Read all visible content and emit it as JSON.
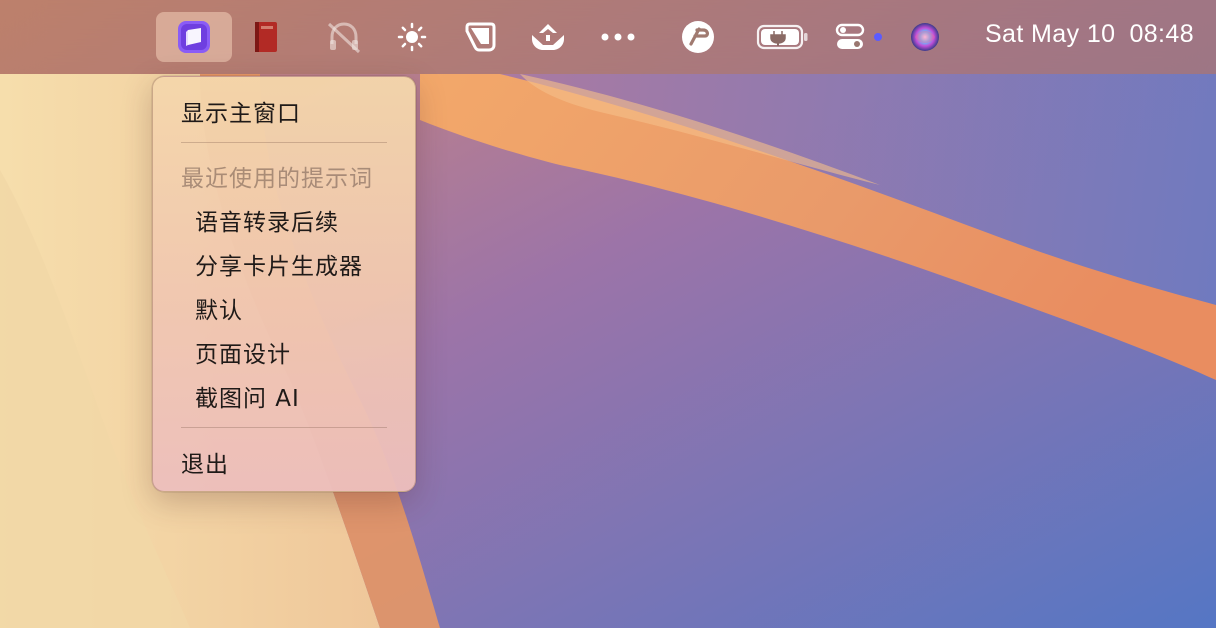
{
  "menubar": {
    "icons": [
      {
        "name": "prompt-app-icon",
        "color": "#7c4dff"
      },
      {
        "name": "book-icon",
        "color": "#c0392b"
      },
      {
        "name": "headphones-off-icon"
      },
      {
        "name": "brightness-icon"
      },
      {
        "name": "screenshot-icon"
      },
      {
        "name": "inbox-tray-icon"
      },
      {
        "name": "more-icon"
      },
      {
        "name": "remote-desktop-icon"
      },
      {
        "name": "battery-charging-icon"
      },
      {
        "name": "control-center-icon"
      },
      {
        "name": "siri-icon"
      }
    ],
    "date": "Sat May 10",
    "time": "08:48",
    "indicator_dot_color": "#5b5bff"
  },
  "menu": {
    "show_main_window": "显示主窗口",
    "recent_header": "最近使用的提示词",
    "recent_items": [
      "语音转录后续",
      "分享卡片生成器",
      "默认",
      "页面设计",
      "截图问 AI"
    ],
    "quit": "退出"
  }
}
